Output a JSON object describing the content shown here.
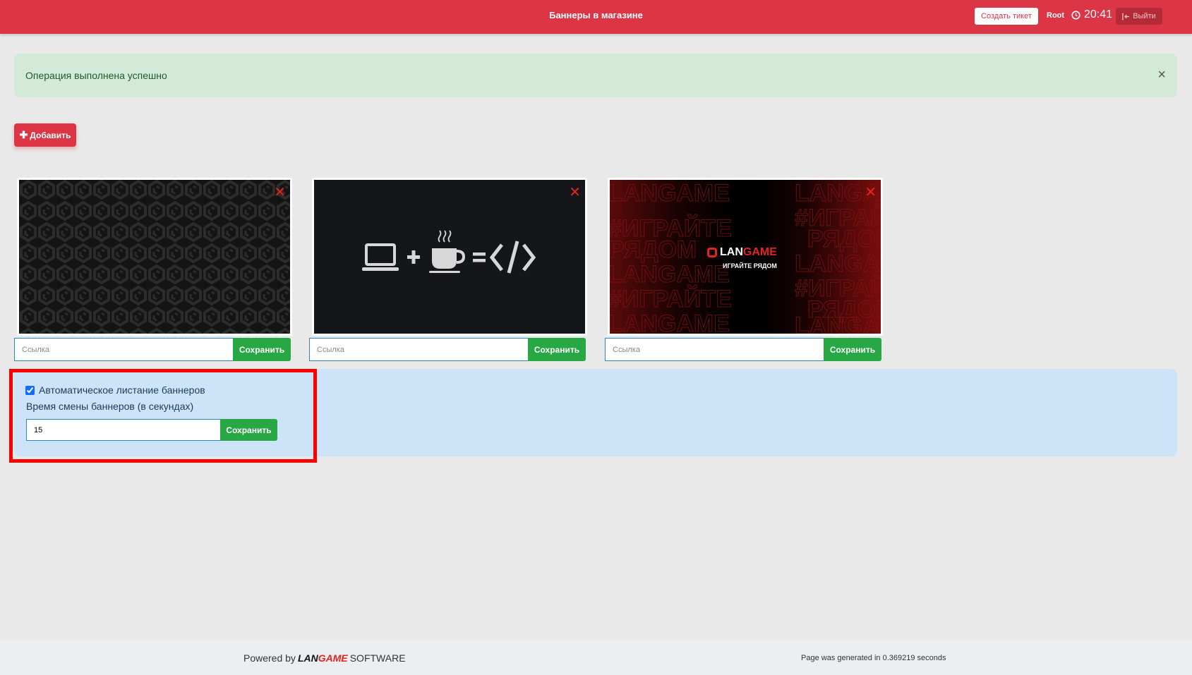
{
  "header": {
    "title": "Баннеры в магазине",
    "ticket_button": "Создать тикет",
    "user": "Root",
    "time": "20:41",
    "logout_button": "Выйти"
  },
  "alert": {
    "message": "Операция выполнена успешно",
    "close": "×"
  },
  "add_button": "Добавить",
  "banners": [
    {
      "image": "dark-pattern-banner",
      "link_placeholder": "Ссылка",
      "save_label": "Сохранить",
      "delete": "✕"
    },
    {
      "image": "laptop-coffee-code-banner",
      "link_placeholder": "Ссылка",
      "save_label": "Сохранить",
      "delete": "✕"
    },
    {
      "image": "langame-banner",
      "link_placeholder": "Ссылка",
      "save_label": "Сохранить",
      "delete": "✕",
      "logo_lan": "LAN",
      "logo_game": "GAME",
      "tagline": "ИГРАЙТЕ РЯДОМ"
    }
  ],
  "settings": {
    "autoplay_label": "Автоматическое листание баннеров",
    "autoplay_checked": true,
    "interval_label": "Время смены баннеров (в секундах)",
    "interval_value": "15",
    "save_label": "Сохранить"
  },
  "footer": {
    "powered_prefix": "Powered by",
    "brand_lan": "LAN",
    "brand_game": "GAME",
    "brand_suffix": "SOFTWARE",
    "generated": "Page was generated in 0.369219 seconds"
  },
  "colors": {
    "accent": "#dc3545",
    "success": "#28a745",
    "highlight": "#ff0000"
  }
}
